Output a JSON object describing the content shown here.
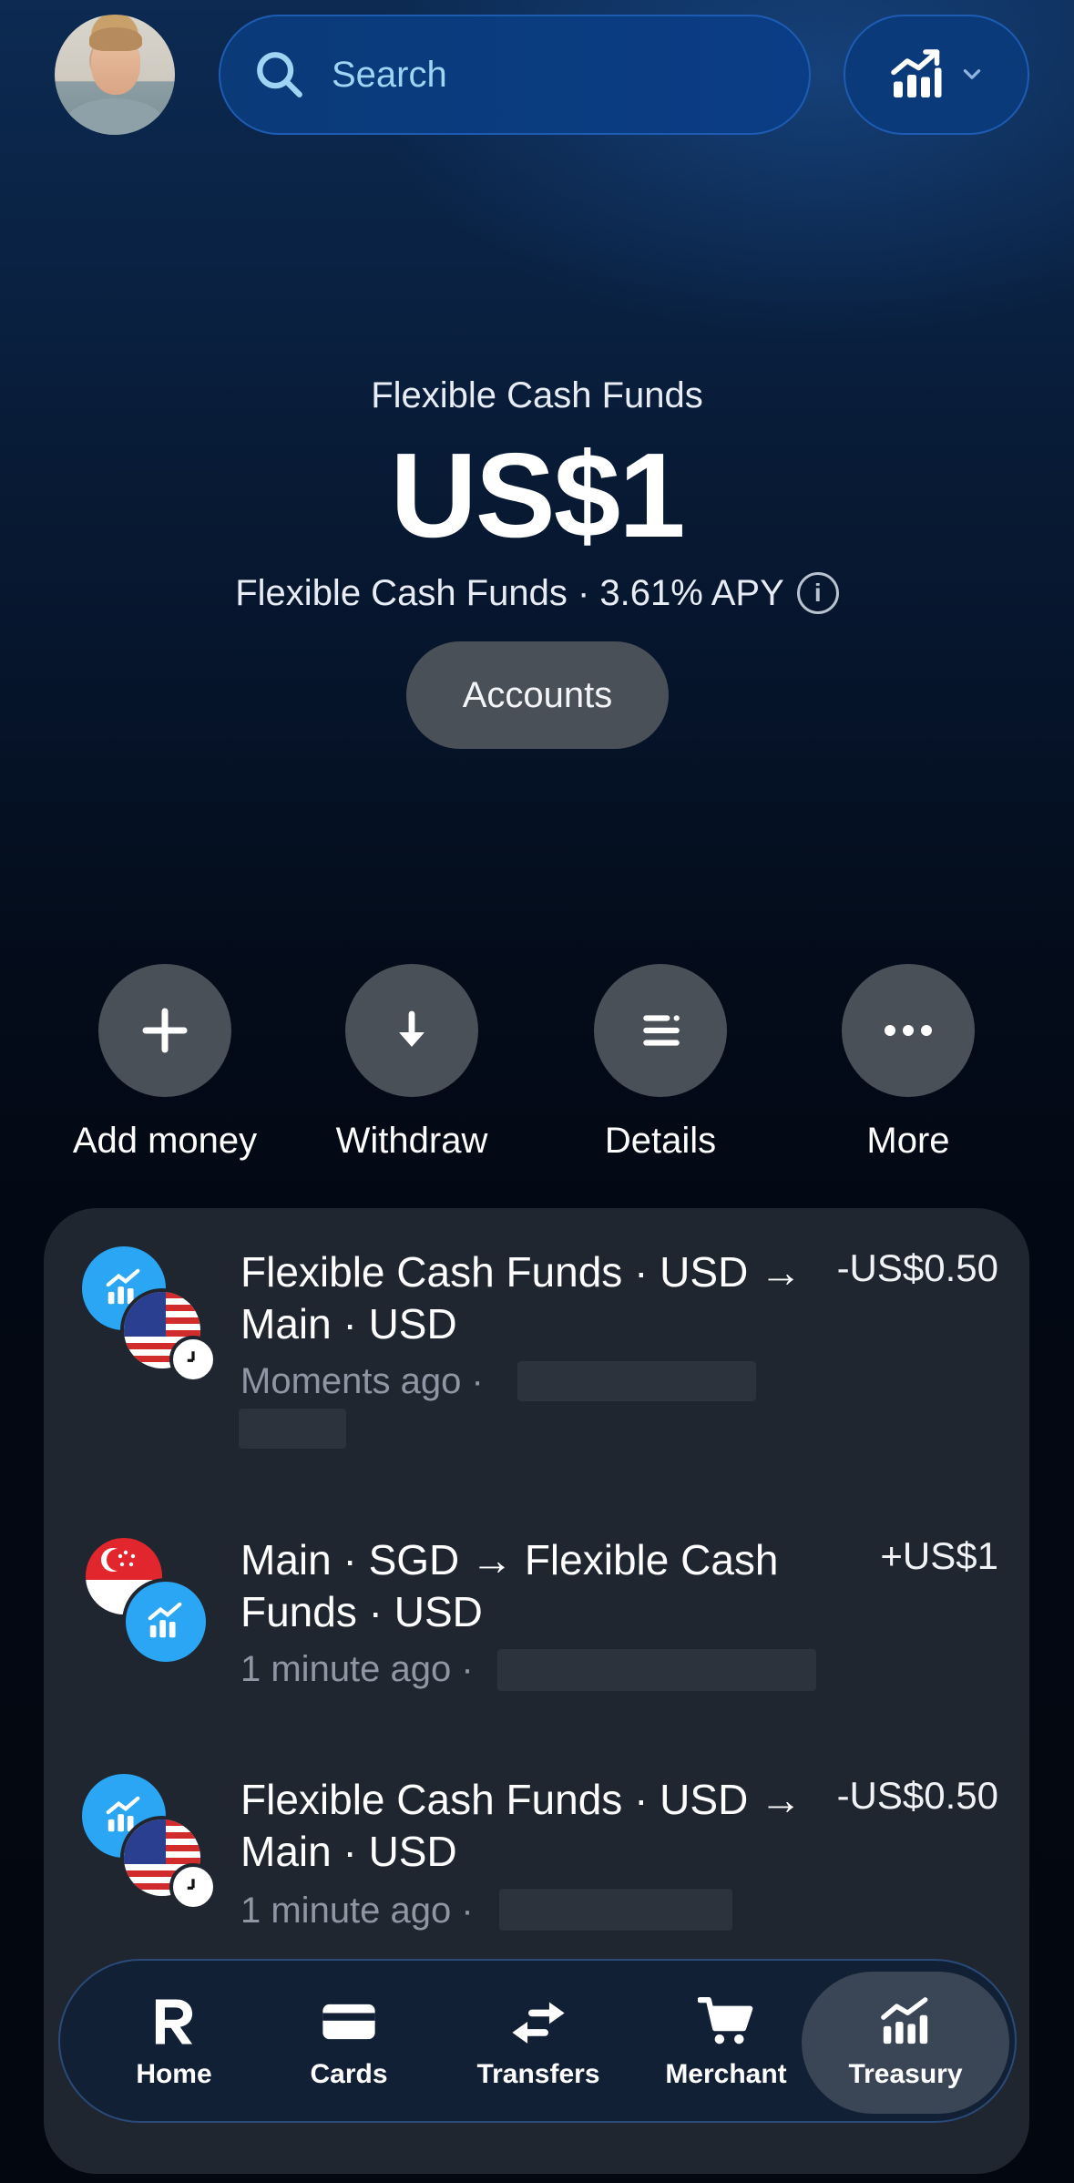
{
  "header": {
    "search_placeholder": "Search"
  },
  "balance": {
    "label": "Flexible Cash Funds",
    "amount": "US$1",
    "subtitle": "Flexible Cash Funds · 3.61% APY",
    "accounts_label": "Accounts"
  },
  "actions": [
    {
      "label": "Add money",
      "icon": "plus-icon"
    },
    {
      "label": "Withdraw",
      "icon": "arrow-down-icon"
    },
    {
      "label": "Details",
      "icon": "details-icon"
    },
    {
      "label": "More",
      "icon": "more-dots-icon"
    }
  ],
  "transactions": [
    {
      "title": "Flexible Cash Funds · USD → Main · USD",
      "amount": "-US$0.50",
      "time": "Moments ago ·"
    },
    {
      "title": "Main · SGD → Flexible Cash Funds · USD",
      "amount": "+US$1",
      "time": "1 minute ago ·"
    },
    {
      "title": "Flexible Cash Funds · USD → Main · USD",
      "amount": "-US$0.50",
      "time": "1 minute ago ·"
    }
  ],
  "nav": {
    "items": [
      {
        "label": "Home"
      },
      {
        "label": "Cards"
      },
      {
        "label": "Transfers"
      },
      {
        "label": "Merchant"
      },
      {
        "label": "Treasury"
      }
    ],
    "active": "Treasury"
  },
  "colors": {
    "accent_blue": "#2aa6f5",
    "button_gray": "#4a5058",
    "card_bg": "#1f2630"
  }
}
